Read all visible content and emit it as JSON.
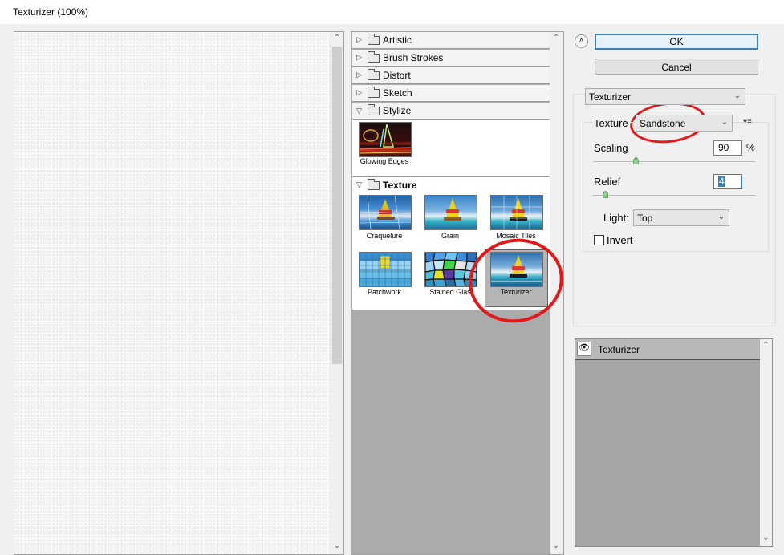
{
  "window": {
    "title": "Texturizer (100%)"
  },
  "categories": [
    {
      "label": "Artistic",
      "expanded": false
    },
    {
      "label": "Brush Strokes",
      "expanded": false
    },
    {
      "label": "Distort",
      "expanded": false
    },
    {
      "label": "Sketch",
      "expanded": false
    },
    {
      "label": "Stylize",
      "expanded": true
    },
    {
      "label": "Texture",
      "expanded": true
    }
  ],
  "stylize_filters": [
    {
      "label": "Glowing Edges"
    }
  ],
  "texture_filters": [
    {
      "label": "Craquelure"
    },
    {
      "label": "Grain"
    },
    {
      "label": "Mosaic Tiles"
    },
    {
      "label": "Patchwork"
    },
    {
      "label": "Stained Glas"
    },
    {
      "label": "Texturizer",
      "selected": true
    }
  ],
  "buttons": {
    "ok": "OK",
    "cancel": "Cancel"
  },
  "settings": {
    "filter_select": "Texturizer",
    "texture_label": "Texture",
    "texture_value": "Sandstone",
    "scaling_label": "Scaling",
    "scaling_value": "90",
    "scaling_unit": "%",
    "relief_label": "Relief",
    "relief_value": "4",
    "light_label": "Light:",
    "light_value": "Top",
    "invert_label": "Invert",
    "invert_checked": false
  },
  "layers": [
    {
      "label": "Texturizer",
      "visible": true
    }
  ],
  "colors": {
    "highlight": "#e11919",
    "selection": "#3c7fb1"
  }
}
